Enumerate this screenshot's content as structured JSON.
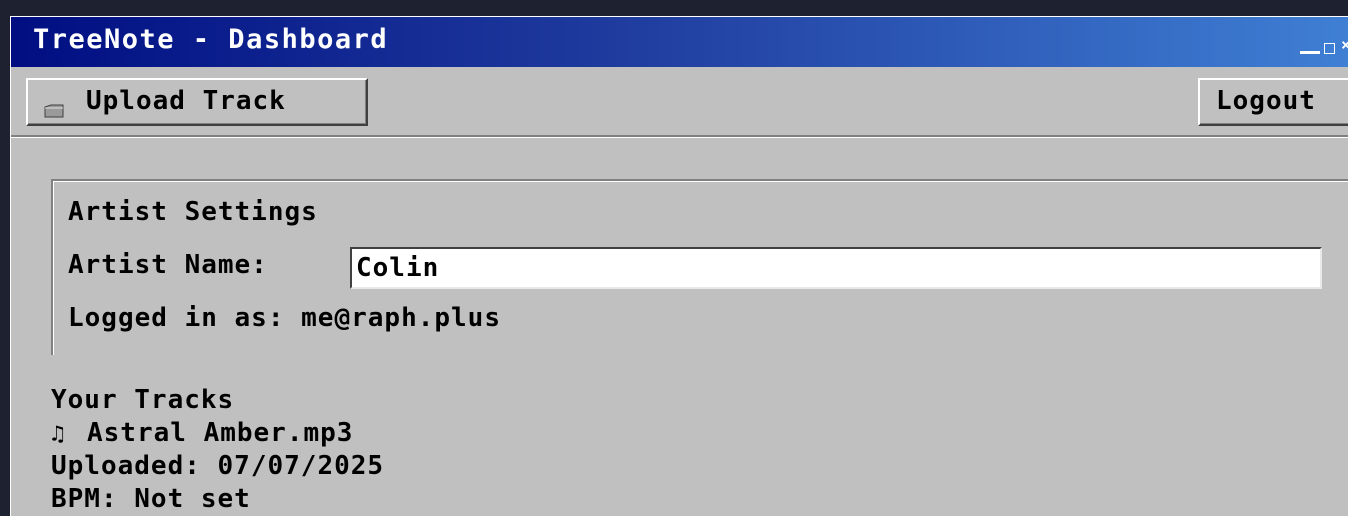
{
  "window": {
    "title": "TreeNote - Dashboard"
  },
  "toolbar": {
    "upload_label": "Upload Track",
    "logout_label": "Logout"
  },
  "settings": {
    "title": "Artist Settings",
    "artist_name_label": "Artist Name:",
    "artist_name_value": "Colin",
    "logged_in_text": "Logged in as: me@raph.plus"
  },
  "tracks": {
    "heading": "Your Tracks",
    "items": [
      {
        "name": "Astral Amber.mp3",
        "uploaded": "Uploaded: 07/07/2025",
        "bpm": "BPM: Not set"
      }
    ]
  },
  "icons": {
    "upload": "folder-icon",
    "track": "music-note-icon",
    "minimize": "minimize-icon",
    "maximize": "maximize-icon",
    "close": "close-icon"
  },
  "colors": {
    "window_bg": "#c0c0c0",
    "titlebar_start": "#000e82",
    "titlebar_end": "#3f7fd4",
    "desktop_bg": "#1e2230"
  }
}
